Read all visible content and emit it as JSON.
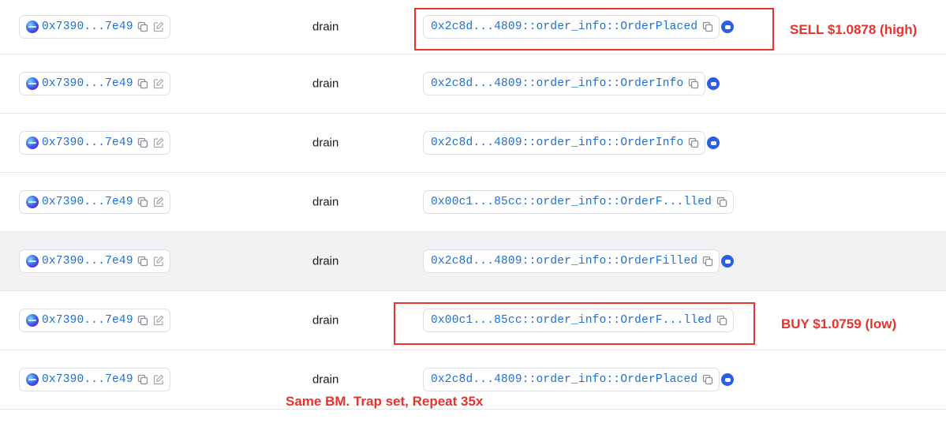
{
  "rows": [
    {
      "from": "0x7390...7e49",
      "function": "drain",
      "type": "0x2c8d...4809::order_info::OrderPlaced",
      "badge": true
    },
    {
      "from": "0x7390...7e49",
      "function": "drain",
      "type": "0x2c8d...4809::order_info::OrderInfo",
      "badge": true
    },
    {
      "from": "0x7390...7e49",
      "function": "drain",
      "type": "0x2c8d...4809::order_info::OrderInfo",
      "badge": true
    },
    {
      "from": "0x7390...7e49",
      "function": "drain",
      "type": "0x00c1...85cc::order_info::OrderF...lled",
      "badge": false
    },
    {
      "from": "0x7390...7e49",
      "function": "drain",
      "type": "0x2c8d...4809::order_info::OrderFilled",
      "badge": true
    },
    {
      "from": "0x7390...7e49",
      "function": "drain",
      "type": "0x00c1...85cc::order_info::OrderF...lled",
      "badge": false
    },
    {
      "from": "0x7390...7e49",
      "function": "drain",
      "type": "0x2c8d...4809::order_info::OrderPlaced",
      "badge": true
    }
  ],
  "annotations": {
    "sell": "SELL  $1.0878 (high)",
    "buy": "BUY  $1.0759 (low)",
    "footer": "Same BM. Trap set, Repeat 35x"
  },
  "colors": {
    "link": "#1f6fd1",
    "annotation": "#e8322b",
    "badge": "#2b5fe0",
    "highlight_row": "#f2f2f4"
  },
  "icons": {
    "copy": "copy-icon",
    "edit": "edit-icon",
    "badge": "sui-token-icon",
    "avatar": "address-avatar"
  }
}
